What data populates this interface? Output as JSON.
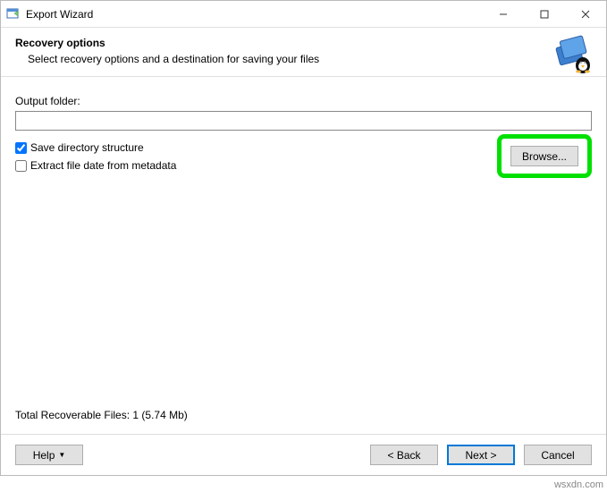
{
  "titlebar": {
    "title": "Export Wizard"
  },
  "header": {
    "title": "Recovery options",
    "subtitle": "Select recovery options and a destination for saving your files"
  },
  "body": {
    "output_label": "Output folder:",
    "output_value": "",
    "check_save_dir": "Save directory structure",
    "check_extract_date": "Extract file date from metadata",
    "browse_label": "Browse...",
    "status": "Total Recoverable Files: 1 (5.74 Mb)"
  },
  "footer": {
    "help": "Help",
    "back": "< Back",
    "next": "Next >",
    "cancel": "Cancel"
  },
  "watermark": "wsxdn.com"
}
